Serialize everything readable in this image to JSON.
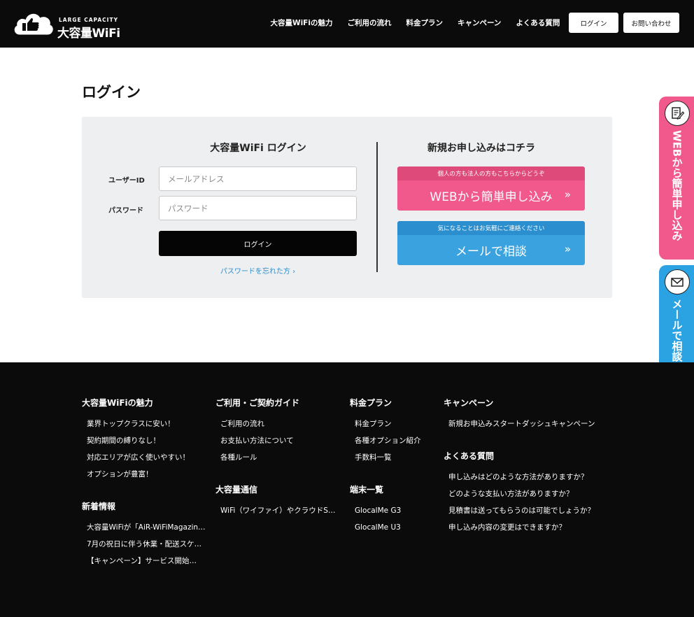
{
  "header": {
    "logo_small": "LARGE CAPACITY",
    "logo_main": "大容量WiFi",
    "nav": [
      "大容量WiFiの魅力",
      "ご利用の流れ",
      "料金プラン",
      "キャンペーン",
      "よくある質問"
    ],
    "login_button": "ログイン",
    "contact_button": "お問い合わせ"
  },
  "main": {
    "title": "ログイン",
    "login_heading": "大容量WiFi ログイン",
    "user_id_label": "ユーザーID",
    "user_id_placeholder": "メールアドレス",
    "password_label": "パスワード",
    "password_placeholder": "パスワード",
    "login_button": "ログイン",
    "forgot_link": "パスワードを忘れた方 ›",
    "signup_heading": "新規お申し込みはコチラ",
    "web_cta_top": "個人の方も法人の方もこちらからどうぞ",
    "web_cta_main": "WEBから簡単申し込み",
    "mail_cta_top": "気になることはお気軽にご連絡ください",
    "mail_cta_main": "メールで相談",
    "cta_arrow": "»"
  },
  "side_tabs": {
    "web": "WEBから簡単申し込み",
    "mail": "メールで相談"
  },
  "footer": {
    "col1": {
      "heading": "大容量WiFiの魅力",
      "links": [
        "業界トップクラスに安い！",
        "契約期間の縛りなし！",
        "対応エリアが広く使いやすい！",
        "オプションが豊富！"
      ],
      "news_heading": "新着情報",
      "news": [
        "大容量WiFiが「AiR-WiFiMagazin…",
        "7月の祝日に伴う休業・配送スケ…",
        "【キャンペーン】サービス開始…"
      ]
    },
    "col2": {
      "heading": "ご利用・ご契約ガイド",
      "links": [
        "ご利用の流れ",
        "お支払い方法について",
        "各種ルール"
      ],
      "heading2": "大容量通信",
      "links2": [
        "WiFi（ワイファイ）やクラウドS…"
      ]
    },
    "col3": {
      "heading": "料金プラン",
      "links": [
        "料金プラン",
        "各種オプション紹介",
        "手数料一覧"
      ],
      "heading2": "端末一覧",
      "links2": [
        "GlocalMe G3",
        "GlocalMe U3"
      ]
    },
    "col4": {
      "heading": "キャンペーン",
      "links": [
        "新規お申込みスタートダッシュキャンペーン"
      ],
      "heading2": "よくある質問",
      "links2": [
        "申し込みはどのような方法がありますか？",
        "どのような支払い方法がありますか？",
        "見積書は送ってもらうのは可能でしょうか？",
        "申し込み内容の変更はできますか？"
      ]
    }
  }
}
